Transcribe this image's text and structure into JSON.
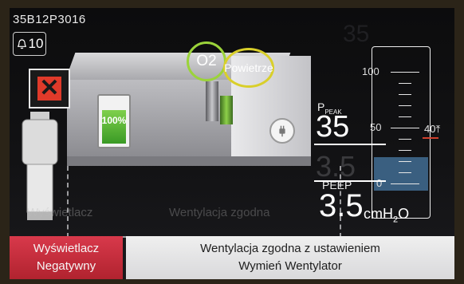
{
  "header": {
    "device_id": "35B12P3016",
    "alarm_count": "10",
    "ghost_reflection": "35"
  },
  "ventilator": {
    "battery_percent": "100%",
    "gas_o2": "O2",
    "gas_air": "Powietrze"
  },
  "pressure": {
    "ppeak_label": "P",
    "ppeak_sub": "PEAK",
    "ppeak_value": "35",
    "peep_label": "PEEP",
    "peep_value": "3.5",
    "peep_ghost": "3.5",
    "unit": "cmH2O",
    "unit_main": "cmH",
    "unit_sub": "2",
    "unit_tail": "O",
    "gauge_ticks": [
      "100",
      "50",
      "0"
    ],
    "limit_label": "40",
    "fill_fraction": 0.2
  },
  "bottom": {
    "neg_line1": "Wyświetlacz",
    "neg_line2": "Negatywny",
    "msg_line1": "Wentylacja zgodna z ustawieniem",
    "msg_line2": "Wymień Wentylator",
    "reflect_left": "Wyświetlacz",
    "reflect_right": "Wentylacja zgodna"
  },
  "colors": {
    "negative_button": "#c42c3c",
    "gauge_fill": "#3a5f80",
    "limit": "#d0402e",
    "gas_ring_o2": "#9bd33a",
    "gas_ring_air": "#d9cf2a"
  },
  "icons": [
    "alarm-bell-icon",
    "error-x-icon",
    "battery-icon",
    "power-plug-icon",
    "limit-arrow-icon"
  ]
}
